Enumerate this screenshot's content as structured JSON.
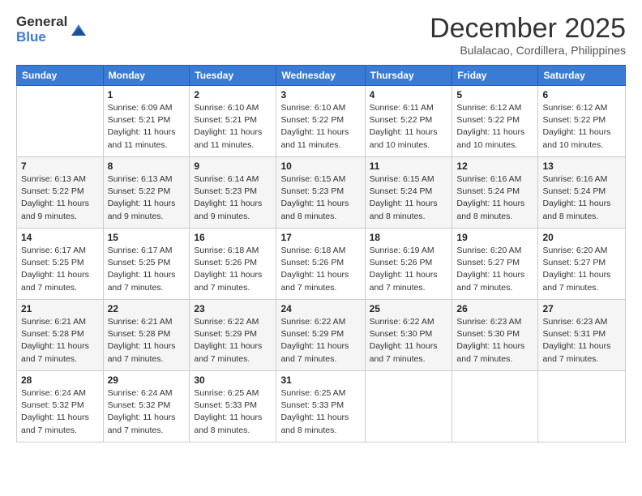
{
  "logo": {
    "general": "General",
    "blue": "Blue"
  },
  "header": {
    "title": "December 2025",
    "subtitle": "Bulalacao, Cordillera, Philippines"
  },
  "days_of_week": [
    "Sunday",
    "Monday",
    "Tuesday",
    "Wednesday",
    "Thursday",
    "Friday",
    "Saturday"
  ],
  "weeks": [
    [
      {
        "day": "",
        "info": ""
      },
      {
        "day": "1",
        "info": "Sunrise: 6:09 AM\nSunset: 5:21 PM\nDaylight: 11 hours\nand 11 minutes."
      },
      {
        "day": "2",
        "info": "Sunrise: 6:10 AM\nSunset: 5:21 PM\nDaylight: 11 hours\nand 11 minutes."
      },
      {
        "day": "3",
        "info": "Sunrise: 6:10 AM\nSunset: 5:22 PM\nDaylight: 11 hours\nand 11 minutes."
      },
      {
        "day": "4",
        "info": "Sunrise: 6:11 AM\nSunset: 5:22 PM\nDaylight: 11 hours\nand 10 minutes."
      },
      {
        "day": "5",
        "info": "Sunrise: 6:12 AM\nSunset: 5:22 PM\nDaylight: 11 hours\nand 10 minutes."
      },
      {
        "day": "6",
        "info": "Sunrise: 6:12 AM\nSunset: 5:22 PM\nDaylight: 11 hours\nand 10 minutes."
      }
    ],
    [
      {
        "day": "7",
        "info": "Sunrise: 6:13 AM\nSunset: 5:22 PM\nDaylight: 11 hours\nand 9 minutes."
      },
      {
        "day": "8",
        "info": "Sunrise: 6:13 AM\nSunset: 5:22 PM\nDaylight: 11 hours\nand 9 minutes."
      },
      {
        "day": "9",
        "info": "Sunrise: 6:14 AM\nSunset: 5:23 PM\nDaylight: 11 hours\nand 9 minutes."
      },
      {
        "day": "10",
        "info": "Sunrise: 6:15 AM\nSunset: 5:23 PM\nDaylight: 11 hours\nand 8 minutes."
      },
      {
        "day": "11",
        "info": "Sunrise: 6:15 AM\nSunset: 5:24 PM\nDaylight: 11 hours\nand 8 minutes."
      },
      {
        "day": "12",
        "info": "Sunrise: 6:16 AM\nSunset: 5:24 PM\nDaylight: 11 hours\nand 8 minutes."
      },
      {
        "day": "13",
        "info": "Sunrise: 6:16 AM\nSunset: 5:24 PM\nDaylight: 11 hours\nand 8 minutes."
      }
    ],
    [
      {
        "day": "14",
        "info": "Sunrise: 6:17 AM\nSunset: 5:25 PM\nDaylight: 11 hours\nand 7 minutes."
      },
      {
        "day": "15",
        "info": "Sunrise: 6:17 AM\nSunset: 5:25 PM\nDaylight: 11 hours\nand 7 minutes."
      },
      {
        "day": "16",
        "info": "Sunrise: 6:18 AM\nSunset: 5:26 PM\nDaylight: 11 hours\nand 7 minutes."
      },
      {
        "day": "17",
        "info": "Sunrise: 6:18 AM\nSunset: 5:26 PM\nDaylight: 11 hours\nand 7 minutes."
      },
      {
        "day": "18",
        "info": "Sunrise: 6:19 AM\nSunset: 5:26 PM\nDaylight: 11 hours\nand 7 minutes."
      },
      {
        "day": "19",
        "info": "Sunrise: 6:20 AM\nSunset: 5:27 PM\nDaylight: 11 hours\nand 7 minutes."
      },
      {
        "day": "20",
        "info": "Sunrise: 6:20 AM\nSunset: 5:27 PM\nDaylight: 11 hours\nand 7 minutes."
      }
    ],
    [
      {
        "day": "21",
        "info": "Sunrise: 6:21 AM\nSunset: 5:28 PM\nDaylight: 11 hours\nand 7 minutes."
      },
      {
        "day": "22",
        "info": "Sunrise: 6:21 AM\nSunset: 5:28 PM\nDaylight: 11 hours\nand 7 minutes."
      },
      {
        "day": "23",
        "info": "Sunrise: 6:22 AM\nSunset: 5:29 PM\nDaylight: 11 hours\nand 7 minutes."
      },
      {
        "day": "24",
        "info": "Sunrise: 6:22 AM\nSunset: 5:29 PM\nDaylight: 11 hours\nand 7 minutes."
      },
      {
        "day": "25",
        "info": "Sunrise: 6:22 AM\nSunset: 5:30 PM\nDaylight: 11 hours\nand 7 minutes."
      },
      {
        "day": "26",
        "info": "Sunrise: 6:23 AM\nSunset: 5:30 PM\nDaylight: 11 hours\nand 7 minutes."
      },
      {
        "day": "27",
        "info": "Sunrise: 6:23 AM\nSunset: 5:31 PM\nDaylight: 11 hours\nand 7 minutes."
      }
    ],
    [
      {
        "day": "28",
        "info": "Sunrise: 6:24 AM\nSunset: 5:32 PM\nDaylight: 11 hours\nand 7 minutes."
      },
      {
        "day": "29",
        "info": "Sunrise: 6:24 AM\nSunset: 5:32 PM\nDaylight: 11 hours\nand 7 minutes."
      },
      {
        "day": "30",
        "info": "Sunrise: 6:25 AM\nSunset: 5:33 PM\nDaylight: 11 hours\nand 8 minutes."
      },
      {
        "day": "31",
        "info": "Sunrise: 6:25 AM\nSunset: 5:33 PM\nDaylight: 11 hours\nand 8 minutes."
      },
      {
        "day": "",
        "info": ""
      },
      {
        "day": "",
        "info": ""
      },
      {
        "day": "",
        "info": ""
      }
    ]
  ]
}
